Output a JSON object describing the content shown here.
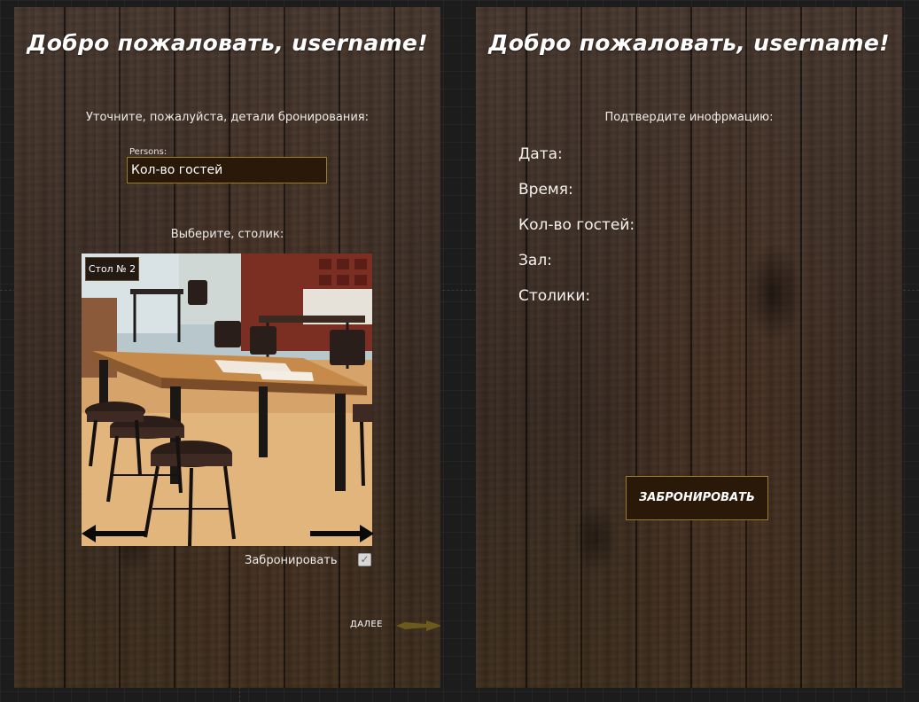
{
  "booking_screen": {
    "greeting": "Добро пожаловать, username!",
    "instruction": "Уточните, пожалуйста, детали бронирования:",
    "persons_label": "Persons:",
    "persons_placeholder": "Кол-во гостей",
    "choose_table_label": "Выберите, столик:",
    "table_tag": "Стол № 2",
    "book_checkbox_label": "Забронировать",
    "book_checkbox_checked": true,
    "next_label": "ДАЛЕЕ"
  },
  "confirm_screen": {
    "greeting": "Добро пожаловать, username!",
    "instruction": "Подтвердите инофрмацию:",
    "fields": [
      {
        "label": "Дата:"
      },
      {
        "label": "Время:"
      },
      {
        "label": "Кол-во гостей:"
      },
      {
        "label": "Зал:"
      },
      {
        "label": "Столики:"
      }
    ],
    "book_button": "ЗАБРОНИРОВАТЬ"
  },
  "icons": {
    "prev": "arrow-left-icon",
    "next": "arrow-right-icon",
    "continue": "arrow-right-icon",
    "check": "check-icon"
  },
  "colors": {
    "input_background": "#2a1808",
    "input_border": "#9a7b2c",
    "next_arrow": "#6b5a1c",
    "workspace_background": "#1c1c1c"
  }
}
